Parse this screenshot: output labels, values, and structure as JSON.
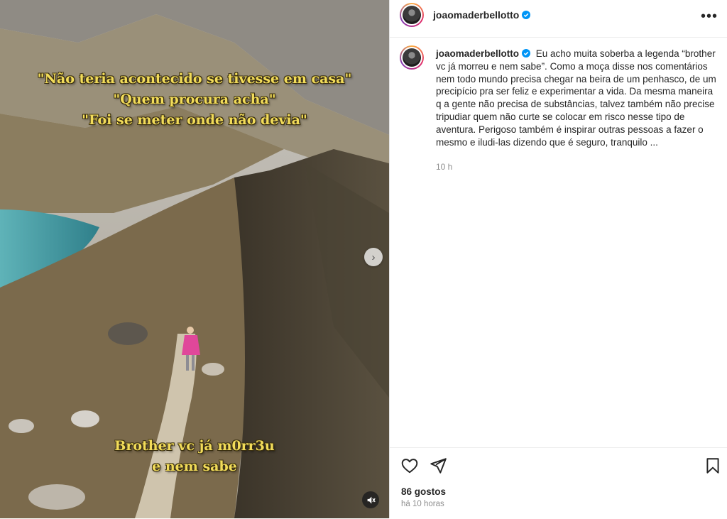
{
  "post": {
    "username": "joaomaderbellotto",
    "verified": true,
    "overlay_text_top": [
      "\"Não teria acontecido se tivesse em casa\"",
      "\"Quem procura acha\"",
      "\"Foi se meter onde não devia\""
    ],
    "overlay_text_bottom": [
      "Brother vc já m0rr3u",
      "e nem sabe"
    ],
    "media_icons": {
      "next": "chevron-right-icon",
      "mute": "speaker-muted-icon"
    }
  },
  "comment": {
    "username": "joaomaderbellotto",
    "text": "Eu acho muita soberba a legenda “brother vc já morreu e nem sabe”. Como a moça disse nos comentários nem todo mundo precisa chegar na beira de um penhasco, de um precipício pra ser feliz e experimentar a vida. Da mesma maneira q a gente não precisa de substâncias, talvez também não precise tripudiar quem não curte se colocar em risco nesse tipo de aventura. Perigoso também é inspirar outras pessoas a fazer o mesmo e iludi-las dizendo que é seguro, tranquilo ...",
    "time": "10 h"
  },
  "actions": {
    "likes": "86 gostos",
    "posted": "há 10 horas",
    "icons": [
      "heart-icon",
      "send-icon",
      "bookmark-icon"
    ]
  },
  "colors": {
    "overlay_text": "#f2dc5a",
    "verified_badge": "#0095f6",
    "secondary_text": "#8e8e8e"
  }
}
